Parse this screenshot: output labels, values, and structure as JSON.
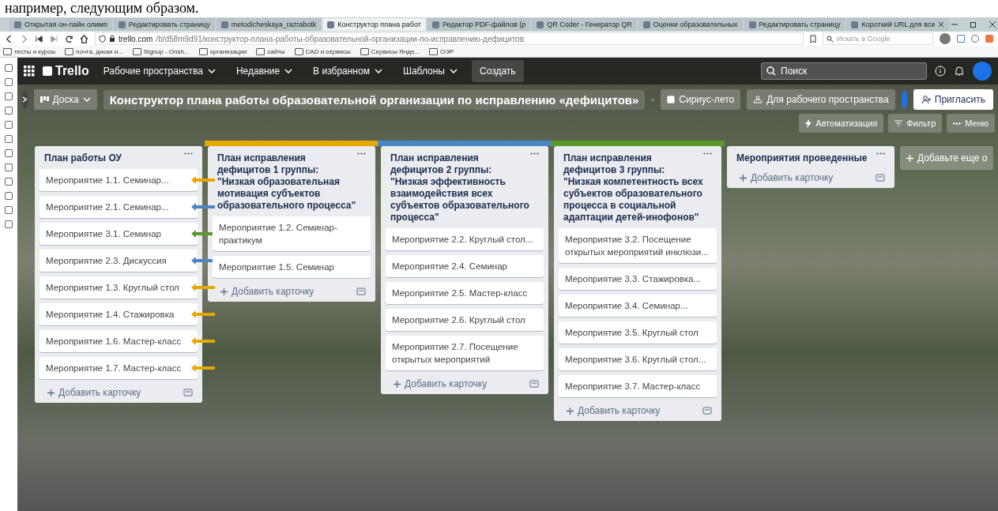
{
  "document_text": "например, следующим образом.",
  "browser": {
    "tabs": [
      {
        "title": "Открытая он-лайн олимп",
        "selected": false
      },
      {
        "title": "Редактировать страницу",
        "selected": false
      },
      {
        "title": "metodicheskaya_razrabotk",
        "selected": false
      },
      {
        "title": "Конструктор плана работ",
        "selected": true
      },
      {
        "title": "Редактор PDF-файлов (p",
        "selected": false
      },
      {
        "title": "QR Coder - Генератор QR",
        "selected": false
      },
      {
        "title": "Оценки образовательных",
        "selected": false
      },
      {
        "title": "Редактировать страницу",
        "selected": false
      },
      {
        "title": "Короткий URL для все",
        "selected": false
      }
    ],
    "address_host": "trello.com",
    "address_path": "/b/d58m9d91/конструктор-плана-работы-образовательной-организации-по-исправлению-дефицитов",
    "search_placeholder": "Искать в Google",
    "bookmarks": [
      "тесты и курсы",
      "почта, диски и...",
      "Signup - Onsh...",
      "организации",
      "сайты",
      "CAD и сервисы",
      "Сервисы Янде...",
      "ОЭР"
    ]
  },
  "trello": {
    "logo": "Trello",
    "nav": [
      "Рабочие пространства",
      "Недавние",
      "В избранном",
      "Шаблоны"
    ],
    "create": "Создать",
    "search_placeholder": "Поиск",
    "board": {
      "view": "Доска",
      "title": "Конструктор плана работы образовательной организации по исправлению «дефицитов»",
      "workspace": "Сириус-лето",
      "visibility": "Для рабочего пространства",
      "invite": "Пригласить",
      "automation": "Автоматизация",
      "filter": "Фильтр",
      "menu": "Меню"
    },
    "lists": [
      {
        "title": "План работы ОУ",
        "add": "Добавить карточку",
        "cards": [
          {
            "text": "Мероприятие 1.1. Семинар...",
            "color": "#e6a800"
          },
          {
            "text": "Мероприятие 2.1. Семинар...",
            "color": "#4a86c5"
          },
          {
            "text": "Мероприятие 3.1. Семинар",
            "color": "#5a9a2a"
          },
          {
            "text": "Мероприятие 2.3. Дискуссия",
            "color": "#4a86c5"
          },
          {
            "text": "Мероприятие 1.3. Круглый стол",
            "color": "#e6a800"
          },
          {
            "text": "Мероприятие 1.4. Стажировка",
            "color": "#e6a800"
          },
          {
            "text": "Мероприятие 1.6. Мастер-класс",
            "color": "#e6a800"
          },
          {
            "text": "Мероприятие 1.7. Мастер-класс",
            "color": "#e6a800"
          }
        ]
      },
      {
        "title": "План исправления дефицитов 1 группы: \"Низкая образовательная мотивация субъектов образовательного процесса\"",
        "color": "#e6a800",
        "add": "Добавить карточку",
        "cards": [
          {
            "text": "Мероприятие 1.2. Семинар-практикум"
          },
          {
            "text": "Мероприятие 1.5. Семинар"
          }
        ]
      },
      {
        "title": "План исправления дефицитов 2 группы: \"Низкая эффективность взаимодействия всех субъектов образовательного процесса\"",
        "color": "#4a86c5",
        "add": "Добавить карточку",
        "cards": [
          {
            "text": "Мероприятие 2.2. Круглый стол..."
          },
          {
            "text": "Мероприятие 2.4. Семинар"
          },
          {
            "text": "Мероприятие 2.5. Мастер-класс"
          },
          {
            "text": "Мероприятие 2.6. Круглый стол"
          },
          {
            "text": "Мероприятие 2.7. Посещение открытых мероприятий"
          }
        ]
      },
      {
        "title": "План исправления дефицитов 3 группы: \"Низкая компетентность всех субъектов образовательного процесса в социальной адаптации детей-инофонов\"",
        "color": "#5a9a2a",
        "add": "Добавить карточку",
        "cards": [
          {
            "text": "Мероприятие 3.2. Посещение открытых мероприятий инклюзи..."
          },
          {
            "text": "Мероприятие 3.3. Стажировка..."
          },
          {
            "text": "Мероприятие 3.4. Семинар..."
          },
          {
            "text": "Мероприятие 3.5. Круглый стол"
          },
          {
            "text": "Мероприятие 3.6. Круглый стол..."
          },
          {
            "text": "Мероприятие 3.7. Мастер-класс"
          }
        ]
      },
      {
        "title": "Мероприятия проведенные",
        "add": "Добавить карточку"
      }
    ],
    "add_list": "Добавьте еще о"
  }
}
